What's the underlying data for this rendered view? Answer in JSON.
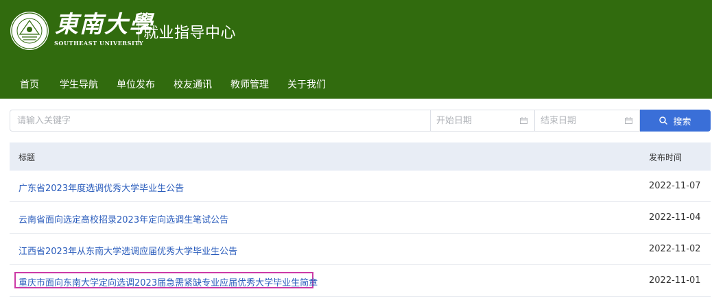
{
  "header": {
    "logo_cn": "東南大學",
    "logo_en": "SOUTHEAST UNIVERSITY",
    "site_title": "就业指导中心",
    "colors": {
      "header_bg": "#316b0e",
      "accent": "#3a6fd8",
      "link": "#2a5cbc"
    }
  },
  "nav": {
    "items": [
      {
        "label": "首页"
      },
      {
        "label": "学生导航"
      },
      {
        "label": "单位发布"
      },
      {
        "label": "校友通讯"
      },
      {
        "label": "教师管理"
      },
      {
        "label": "关于我们"
      }
    ]
  },
  "search": {
    "keyword_placeholder": "请输入关键字",
    "start_date_placeholder": "开始日期",
    "end_date_placeholder": "结束日期",
    "button_label": "搜索",
    "button_icon": "search-icon",
    "date_icon": "calendar-icon"
  },
  "table": {
    "columns": {
      "title": "标题",
      "date": "发布时间"
    },
    "rows": [
      {
        "title": "广东省2023年度选调优秀大学毕业生公告",
        "date": "2022-11-07"
      },
      {
        "title": "云南省面向选定高校招录2023年定向选调生笔试公告",
        "date": "2022-11-04"
      },
      {
        "title": "江西省2023年从东南大学选调应届优秀大学毕业生公告",
        "date": "2022-11-02"
      },
      {
        "title": "重庆市面向东南大学定向选调2023届急需紧缺专业应届优秀大学毕业生简章",
        "date": "2022-11-01",
        "highlighted": true
      }
    ]
  }
}
